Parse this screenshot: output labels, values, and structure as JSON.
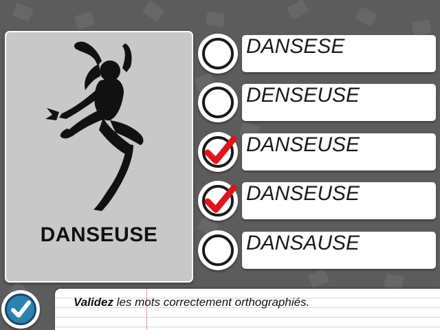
{
  "word": "DANSEUSE",
  "options": [
    {
      "label": "DANSESE",
      "checked": false
    },
    {
      "label": "DENSEUSE",
      "checked": false
    },
    {
      "label": "DANSEUSE",
      "checked": true
    },
    {
      "label": "DANSEUSE",
      "checked": true
    },
    {
      "label": "DANSAUSE",
      "checked": false
    }
  ],
  "instruction": {
    "bold": "Validez",
    "rest": " les mots correctement orthographiés."
  },
  "colors": {
    "background": "#5c5c5c",
    "card": "#c8c8c8",
    "check": "#e0141e",
    "validate": "#2d80b0"
  },
  "icons": {
    "validate": "checkmark-icon",
    "selected": "red-checkmark-icon",
    "unselected": "empty-circle-icon",
    "illustration": "dancer-silhouette"
  }
}
